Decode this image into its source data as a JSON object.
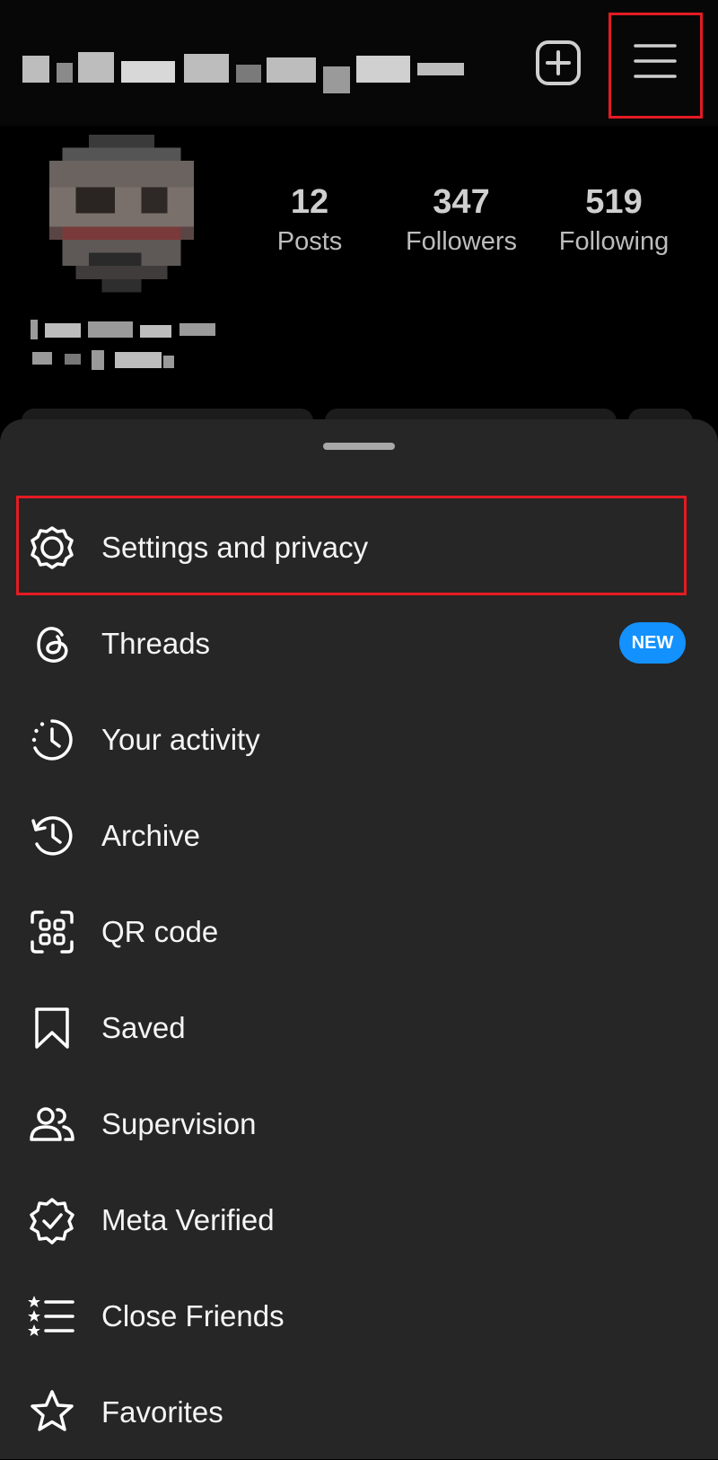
{
  "header": {
    "add_icon": "plus-square-icon",
    "menu_icon": "hamburger-menu-icon"
  },
  "profile": {
    "stats": [
      {
        "value": "12",
        "label": "Posts"
      },
      {
        "value": "347",
        "label": "Followers"
      },
      {
        "value": "519",
        "label": "Following"
      }
    ]
  },
  "menu": {
    "items": [
      {
        "label": "Settings and privacy",
        "icon": "gear-icon"
      },
      {
        "label": "Threads",
        "icon": "threads-icon",
        "badge": "NEW"
      },
      {
        "label": "Your activity",
        "icon": "activity-clock-icon"
      },
      {
        "label": "Archive",
        "icon": "archive-clock-icon"
      },
      {
        "label": "QR code",
        "icon": "qr-code-icon"
      },
      {
        "label": "Saved",
        "icon": "bookmark-icon"
      },
      {
        "label": "Supervision",
        "icon": "supervision-icon"
      },
      {
        "label": "Meta Verified",
        "icon": "verified-badge-icon"
      },
      {
        "label": "Close Friends",
        "icon": "close-friends-icon"
      },
      {
        "label": "Favorites",
        "icon": "star-icon"
      }
    ]
  },
  "colors": {
    "highlight": "#e41b23",
    "badge": "#1391ff",
    "sheet": "#262626",
    "background": "#000000"
  }
}
